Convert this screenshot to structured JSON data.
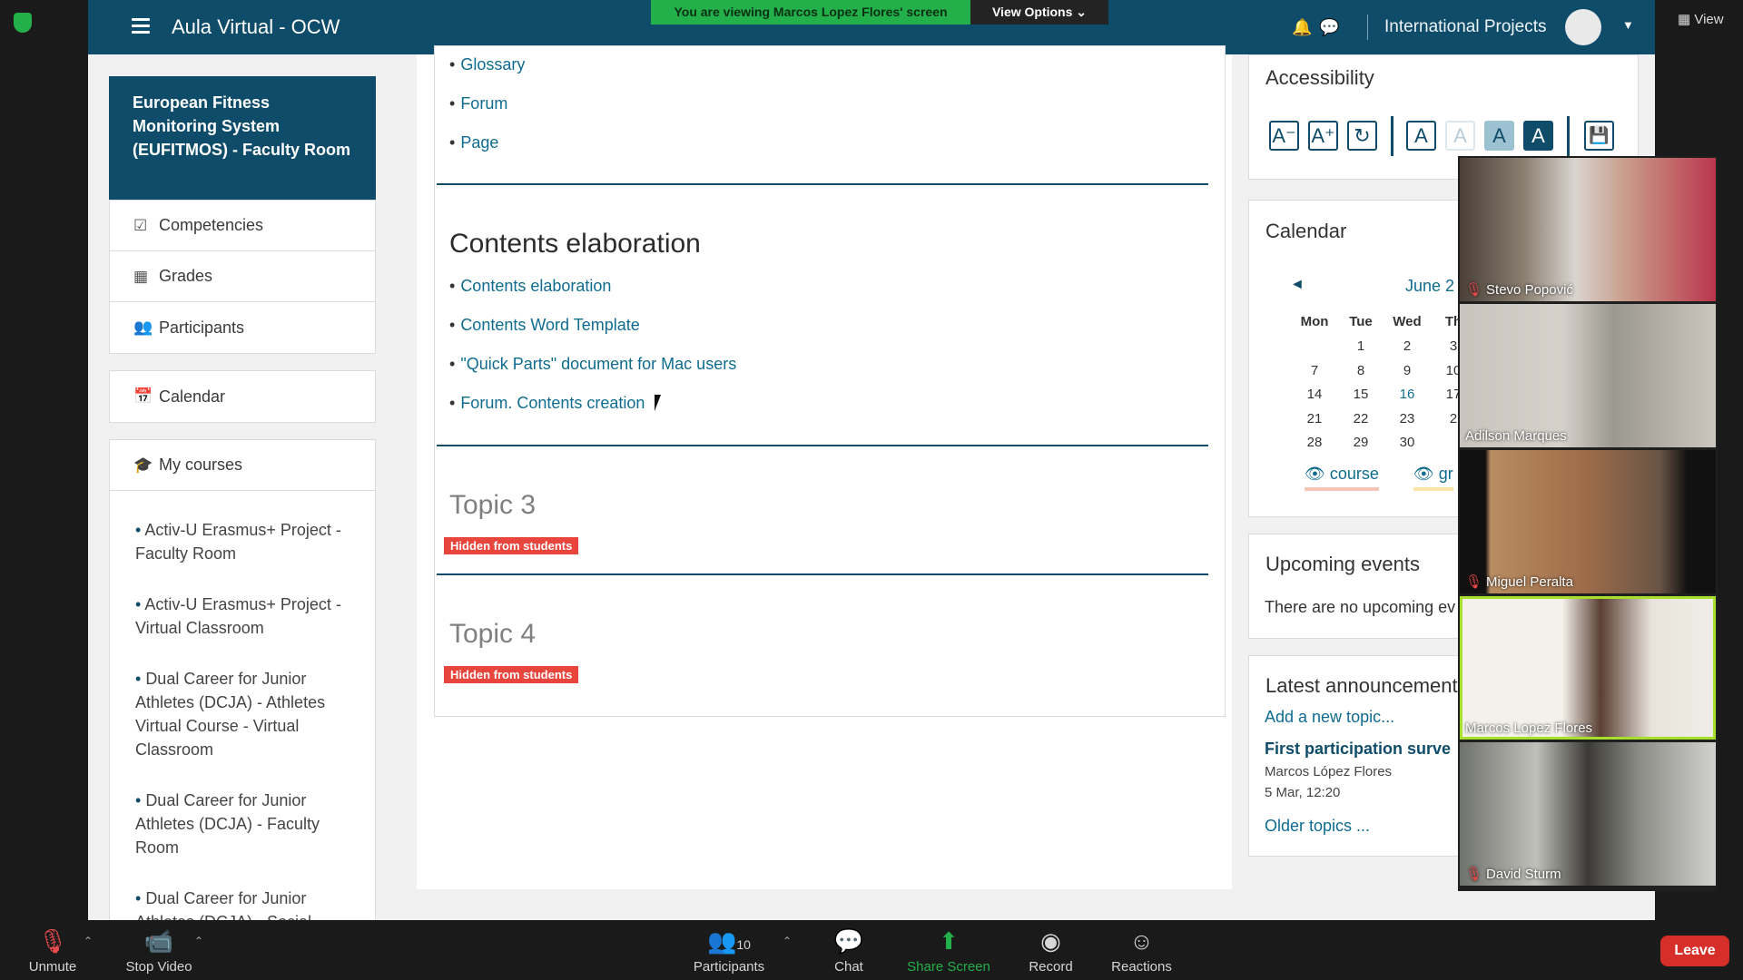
{
  "zoom": {
    "share_banner": "You are viewing Marcos Lopez Flores' screen",
    "view_options": "View Options",
    "view_button": "View",
    "toolbar": {
      "unmute": "Unmute",
      "stop_video": "Stop Video",
      "participants": "Participants",
      "participants_count": "10",
      "chat": "Chat",
      "share_screen": "Share Screen",
      "record": "Record",
      "reactions": "Reactions",
      "leave": "Leave"
    },
    "gallery": [
      {
        "name": "Stevo Popović",
        "muted": true
      },
      {
        "name": "Adilson Marques",
        "muted": false
      },
      {
        "name": "Miguel Peralta",
        "muted": true
      },
      {
        "name": "Marcos Lopez Flores",
        "muted": false,
        "active": true
      },
      {
        "name": "David Sturm",
        "muted": true
      }
    ],
    "colors": {
      "green": "#23b04a",
      "leave_red": "#d62f29",
      "active_border": "#a6df2c"
    }
  },
  "moodle": {
    "site_title": "Aula Virtual - OCW",
    "user_name": "International Projects",
    "course_title": "European Fitness Monitoring System (EUFITMOS) - Faculty Room",
    "nav": {
      "competencies": "Competencies",
      "grades": "Grades",
      "participants": "Participants",
      "calendar": "Calendar",
      "my_courses": "My courses"
    },
    "my_courses": [
      "Activ-U Erasmus+ Project - Faculty Room",
      "Activ-U Erasmus+ Project - Virtual Classroom",
      "Dual Career for Junior Athletes (DCJA) - Athletes Virtual Course - Virtual Classroom",
      "Dual Career for Junior Athletes (DCJA) - Faculty Room",
      "Dual Career for Junior Athletes (DCJA) - Social"
    ],
    "top_links": [
      "Glossary",
      "Forum",
      "Page"
    ],
    "section_title": "Contents elaboration",
    "section_links": [
      "Contents elaboration",
      "Contents Word Template",
      "\"Quick Parts\" document for Mac users",
      "Forum. Contents creation"
    ],
    "topic3": "Topic 3",
    "topic4": "Topic 4",
    "hidden_badge": "Hidden from students",
    "accessibility": {
      "title": "Accessibility",
      "buttons": [
        "A⁻",
        "A⁺",
        "↻",
        "A",
        "A",
        "A",
        "A",
        "💾"
      ]
    },
    "calendar": {
      "title": "Calendar",
      "month": "June 2",
      "prev": "◄",
      "days": [
        "Mon",
        "Tue",
        "Wed",
        "Th"
      ],
      "rows": [
        [
          "",
          "1",
          "2",
          "3"
        ],
        [
          "7",
          "8",
          "9",
          "10"
        ],
        [
          "14",
          "15",
          "16",
          "17"
        ],
        [
          "21",
          "22",
          "23",
          "2"
        ],
        [
          "28",
          "29",
          "30",
          ""
        ]
      ],
      "today": "16",
      "key_course": "course",
      "key_group": "gr"
    },
    "upcoming": {
      "title": "Upcoming events",
      "text": "There are no upcoming ev"
    },
    "announcements": {
      "title": "Latest announcement",
      "add_link": "Add a new topic...",
      "post_title": "First participation surve",
      "author": "Marcos López Flores",
      "date": "5 Mar, 12:20",
      "older": "Older topics ..."
    },
    "colors": {
      "brand": "#0f4c6a",
      "link": "#0f6c8f",
      "badge": "#e8453c"
    }
  }
}
